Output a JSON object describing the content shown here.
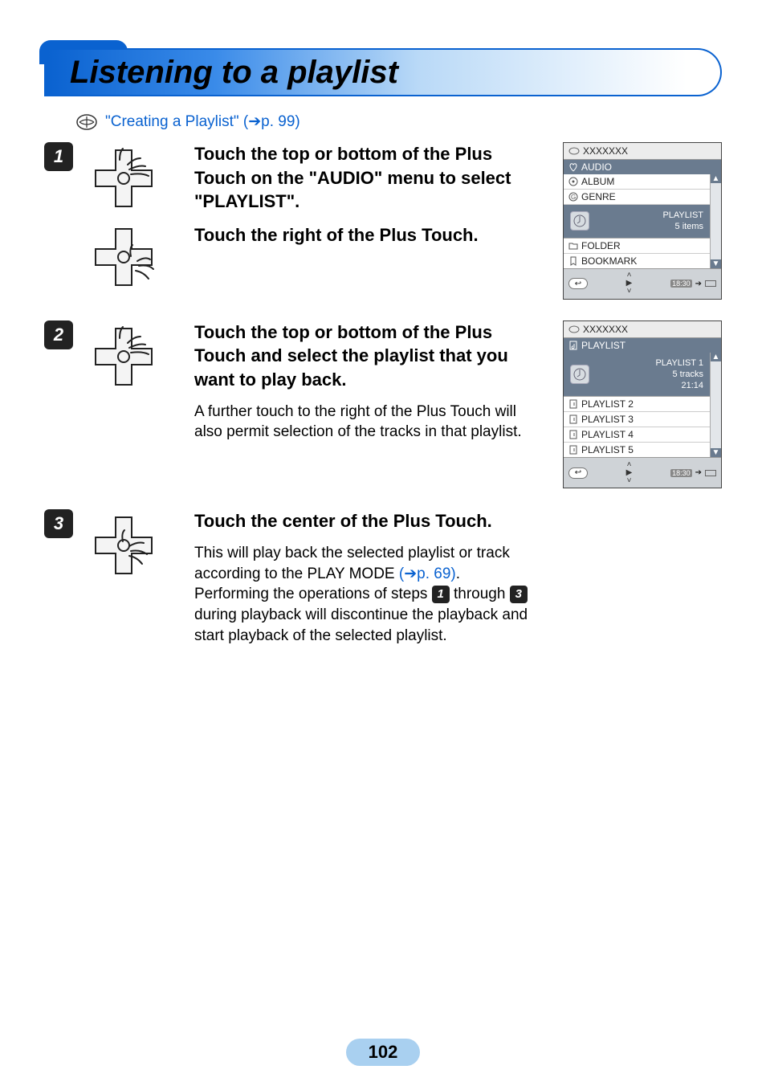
{
  "header": {
    "title": "Listening to a playlist"
  },
  "reference": {
    "label": "\"Creating a Playlist\"",
    "page_ref": "p. 99"
  },
  "steps": [
    {
      "num": "1",
      "bold1": "Touch the top or bottom of the Plus Touch on the \"AUDIO\" menu to select \"PLAYLIST\".",
      "bold2": "Touch the right of the Plus Touch."
    },
    {
      "num": "2",
      "bold1": "Touch the top or bottom of the Plus Touch and select the playlist that you want to play back.",
      "body": "A further touch to the right of the Plus Touch will also permit selection of the tracks in that playlist."
    },
    {
      "num": "3",
      "bold1": "Touch the center of the Plus Touch.",
      "body_pre": "This will play back the selected playlist or track according to the PLAY MODE ",
      "play_mode_ref": "p. 69",
      "body_post1": "Performing the operations of steps ",
      "body_post2": " through ",
      "body_post3": " during playback will discontinue the playback and start playback of the selected playlist.",
      "inline_step_a": "1",
      "inline_step_b": "3"
    }
  ],
  "screen1": {
    "title": "XXXXXXX",
    "section": "AUDIO",
    "rows_before": [
      "ALBUM",
      "GENRE"
    ],
    "highlight": {
      "title": "PLAYLIST",
      "sub": "5 items"
    },
    "rows_after": [
      "FOLDER",
      "BOOKMARK"
    ],
    "time": "18:30"
  },
  "screen2": {
    "title": "XXXXXXX",
    "section": "PLAYLIST",
    "highlight": {
      "title": "PLAYLIST 1",
      "sub1": "5 tracks",
      "sub2": "21:14"
    },
    "rows_after": [
      "PLAYLIST 2",
      "PLAYLIST 3",
      "PLAYLIST 4",
      "PLAYLIST 5"
    ],
    "time": "18:30"
  },
  "page_number": "102"
}
